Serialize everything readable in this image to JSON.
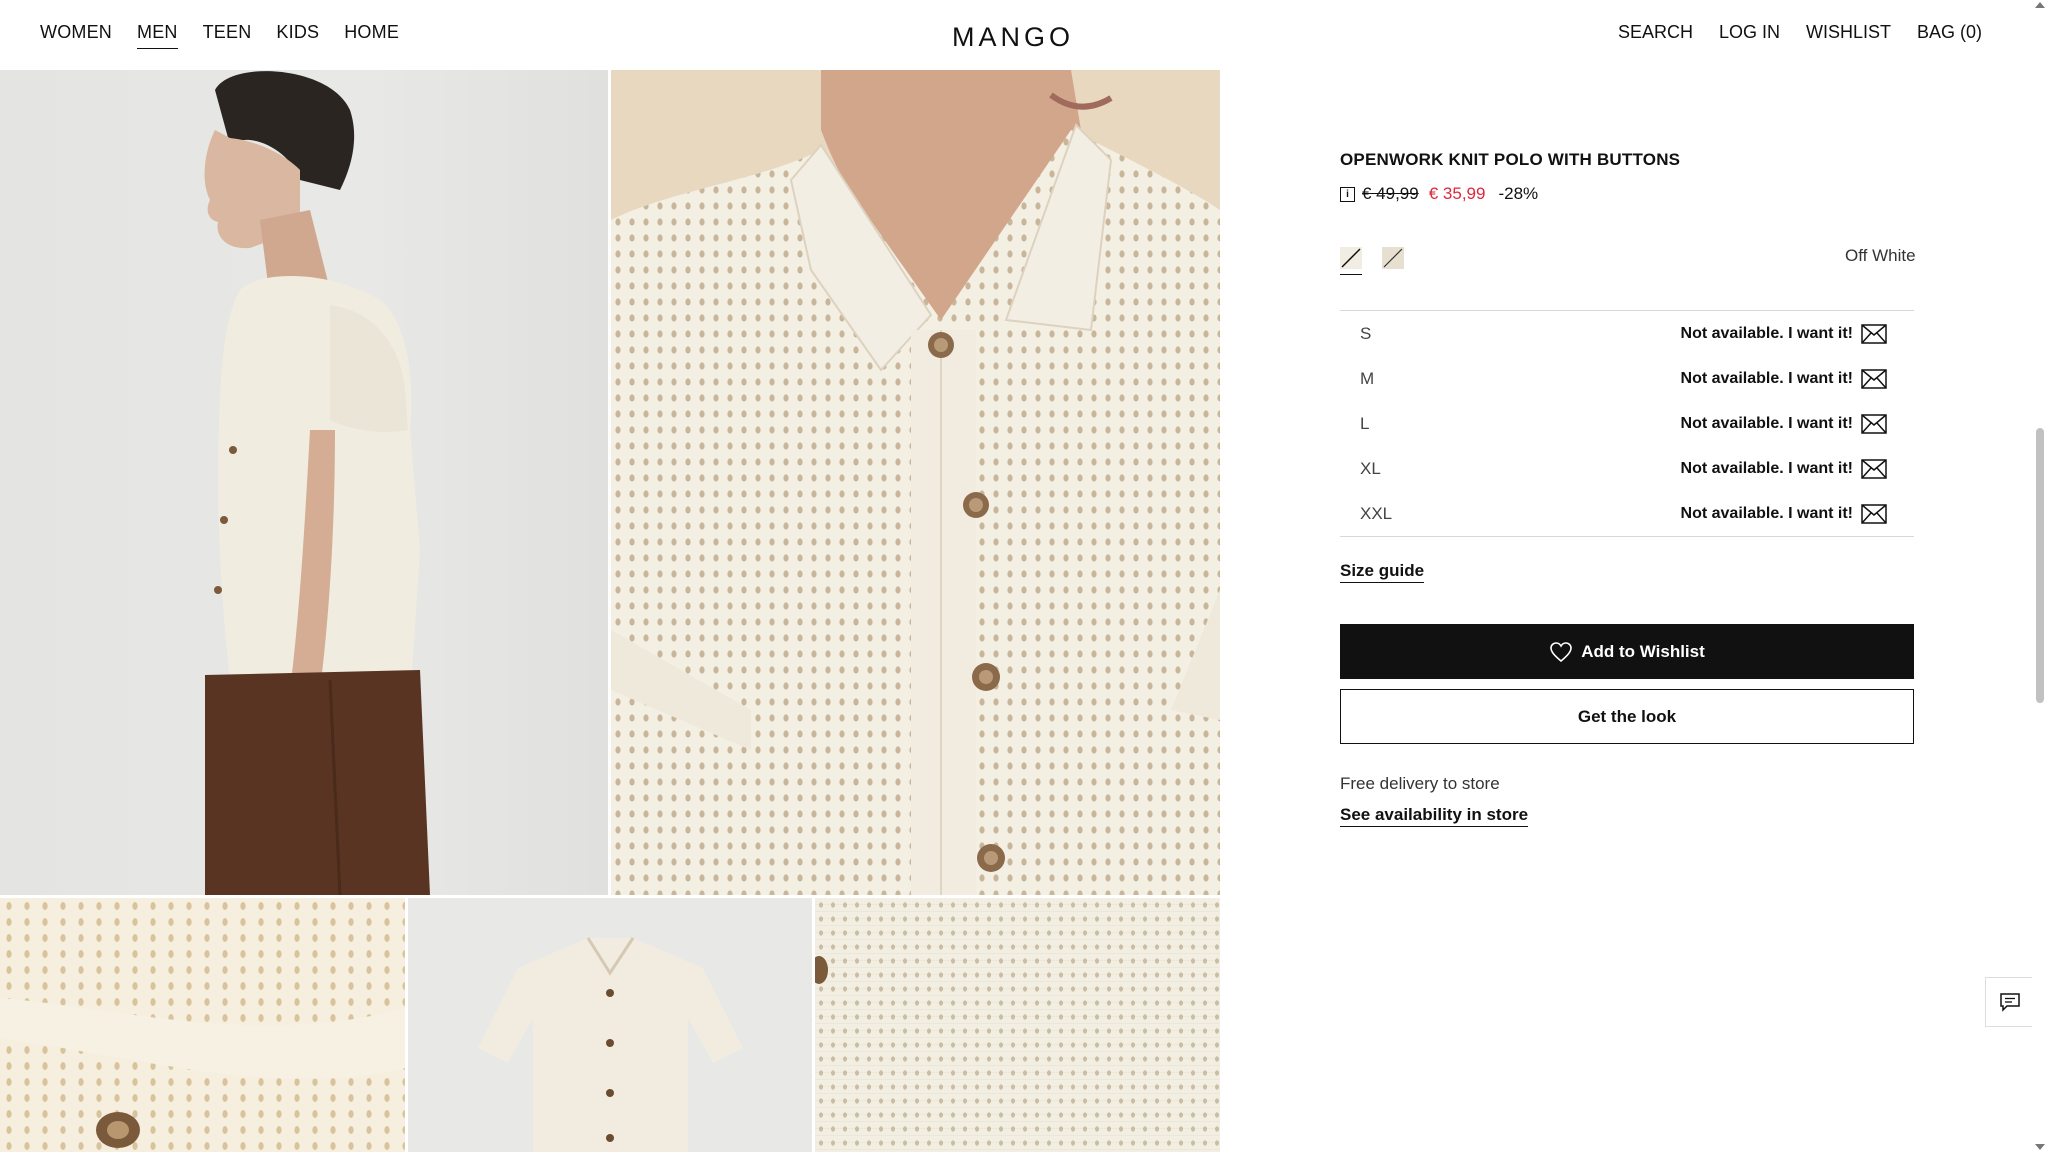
{
  "header": {
    "nav": [
      "WOMEN",
      "MEN",
      "TEEN",
      "KIDS",
      "HOME"
    ],
    "active_nav": "MEN",
    "logo": "MANGO",
    "right_nav": {
      "search": "SEARCH",
      "login": "LOG IN",
      "wishlist": "WISHLIST",
      "bag": "BAG (0)"
    }
  },
  "product": {
    "title": "OPENWORK KNIT POLO WITH BUTTONS",
    "info_icon": "i",
    "old_price": "€ 49,99",
    "new_price": "€ 35,99",
    "discount": "-28%",
    "color_name": "Off White",
    "sizes": [
      {
        "label": "S",
        "status": "Not available. I want it!"
      },
      {
        "label": "M",
        "status": "Not available. I want it!"
      },
      {
        "label": "L",
        "status": "Not available. I want it!"
      },
      {
        "label": "XL",
        "status": "Not available. I want it!"
      },
      {
        "label": "XXL",
        "status": "Not available. I want it!"
      }
    ],
    "size_guide": "Size guide",
    "add_to_wishlist": "Add to Wishlist",
    "get_the_look": "Get the look",
    "delivery": "Free delivery to store",
    "availability": "See availability in store"
  },
  "colors": {
    "price_red": "#e0263b",
    "button_black": "#111111",
    "swatch_off_white": "#f2ede2",
    "swatch_beige": "#e7dfd0"
  }
}
